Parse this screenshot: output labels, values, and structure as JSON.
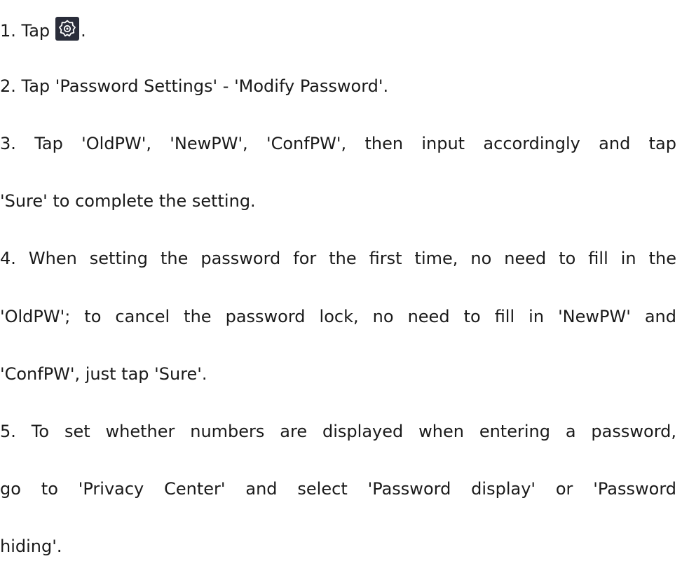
{
  "steps": [
    {
      "prefix": "1. Tap",
      "icon": "settings-gear-icon",
      "suffix": "."
    },
    {
      "text": "2. Tap 'Password Settings' - 'Modify Password'."
    },
    {
      "lines": [
        "3. Tap 'OldPW', 'NewPW', 'ConfPW', then input accordingly and tap",
        "'Sure' to complete the setting."
      ]
    },
    {
      "lines": [
        "4. When setting the password for the first time, no need to fill in the",
        "'OldPW'; to cancel the password lock, no need to fill in 'NewPW' and",
        "'ConfPW', just tap 'Sure'."
      ]
    },
    {
      "lines": [
        "5. To set whether numbers are displayed when entering a password,",
        "go to 'Privacy Center' and select 'Password display' or 'Password",
        "hiding'."
      ]
    }
  ],
  "colors": {
    "text": "#1a1a1a",
    "icon_background": "#2a2d3a",
    "icon_stroke": "#ffffff"
  }
}
